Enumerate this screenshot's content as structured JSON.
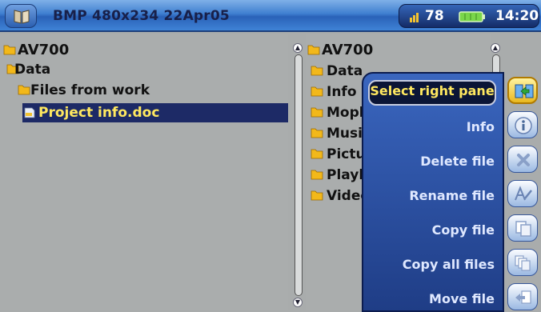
{
  "topbar": {
    "title": "BMP 480x234 22Apr05",
    "volume": "78",
    "clock": "14:20"
  },
  "left_pane": {
    "rows": [
      {
        "label": "AV700"
      },
      {
        "label": "Data"
      },
      {
        "label": "Files from work"
      },
      {
        "label": "Project info.doc"
      }
    ]
  },
  "right_pane": {
    "rows": [
      {
        "label": "AV700"
      },
      {
        "label": "Data"
      },
      {
        "label": "Info"
      },
      {
        "label": "Moph"
      },
      {
        "label": "Musi"
      },
      {
        "label": "Pictu"
      },
      {
        "label": "Playl"
      },
      {
        "label": "Videc"
      }
    ]
  },
  "menu": {
    "items": [
      {
        "label": "Select right pane",
        "icon": "select-pane-icon"
      },
      {
        "label": "Info",
        "icon": "info-icon"
      },
      {
        "label": "Delete file",
        "icon": "delete-icon"
      },
      {
        "label": "Rename file",
        "icon": "rename-icon"
      },
      {
        "label": "Copy file",
        "icon": "copy-icon"
      },
      {
        "label": "Copy all files",
        "icon": "copy-all-icon"
      },
      {
        "label": "Move file",
        "icon": "move-icon"
      }
    ]
  },
  "colors": {
    "selection_bg": "#1d2a66",
    "selection_text": "#ffe860",
    "menu_bg": "#2d55aa"
  }
}
